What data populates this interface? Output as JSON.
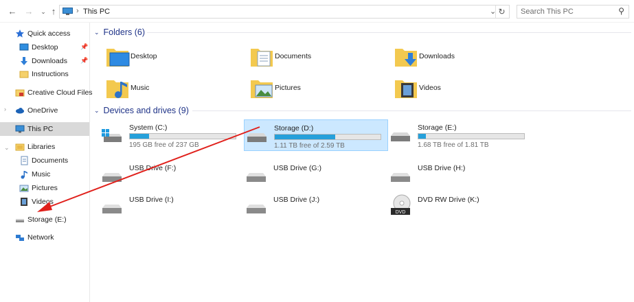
{
  "address_bar": {
    "path": "This PC",
    "search_placeholder": "Search This PC"
  },
  "sidebar": {
    "quick_access": "Quick access",
    "quick_items": [
      "Desktop",
      "Downloads",
      "Instructions"
    ],
    "creative_cloud": "Creative Cloud Files",
    "onedrive": "OneDrive",
    "this_pc": "This PC",
    "libraries": "Libraries",
    "library_items": [
      "Documents",
      "Music",
      "Pictures",
      "Videos"
    ],
    "storage_e": "Storage (E:)",
    "network": "Network"
  },
  "folders": {
    "header": "Folders (6)",
    "items": [
      "Desktop",
      "Documents",
      "Downloads",
      "Music",
      "Pictures",
      "Videos"
    ]
  },
  "drives": {
    "header": "Devices and drives (9)",
    "items": [
      {
        "name": "System (C:)",
        "free": "195 GB free of 237 GB",
        "used_fraction": 0.18
      },
      {
        "name": "Storage (D:)",
        "free": "1.11 TB free of 2.59 TB",
        "used_fraction": 0.57
      },
      {
        "name": "Storage (E:)",
        "free": "1.68 TB free of 1.81 TB",
        "used_fraction": 0.07
      },
      {
        "name": "USB Drive (F:)"
      },
      {
        "name": "USB Drive (G:)"
      },
      {
        "name": "USB Drive (H:)"
      },
      {
        "name": "USB Drive (I:)"
      },
      {
        "name": "USB Drive (J:)"
      },
      {
        "name": "DVD RW Drive (K:)",
        "badge": "DVD"
      }
    ]
  },
  "colors": {
    "accent": "#26a0da",
    "group_header": "#1e3287",
    "selection": "#cce8ff",
    "annotation_arrow": "#e0201b"
  }
}
